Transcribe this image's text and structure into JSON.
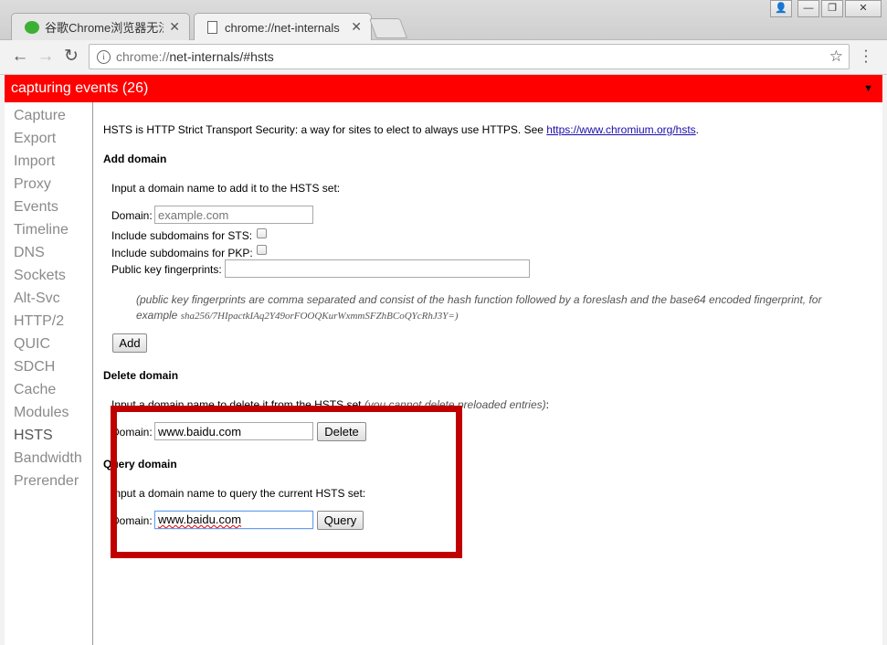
{
  "browser": {
    "tabs": [
      {
        "title": "谷歌Chrome浏览器无法",
        "icon": "wechat-icon"
      },
      {
        "title": "chrome://net-internals",
        "icon": "page-icon"
      }
    ],
    "window_buttons": [
      "user-icon",
      "minimize-icon",
      "restore-icon",
      "close-icon"
    ],
    "omnibox": {
      "scheme": "chrome://",
      "rest": "net-internals/#hsts"
    }
  },
  "status_bar": {
    "text": "capturing events (26)",
    "color": "#ff0000"
  },
  "sidebar": {
    "items": [
      "Capture",
      "Export",
      "Import",
      "Proxy",
      "Events",
      "Timeline",
      "DNS",
      "Sockets",
      "Alt-Svc",
      "HTTP/2",
      "QUIC",
      "SDCH",
      "Cache",
      "Modules",
      "HSTS",
      "Bandwidth",
      "Prerender"
    ],
    "active": "HSTS"
  },
  "hsts": {
    "intro": "HSTS is HTTP Strict Transport Security: a way for sites to elect to always use HTTPS. See ",
    "intro_link": "https://www.chromium.org/hsts",
    "intro_end": ".",
    "add": {
      "heading": "Add domain",
      "instruction": "Input a domain name to add it to the HSTS set:",
      "domain_label": "Domain:",
      "domain_placeholder": "example.com",
      "sts_label": "Include subdomains for STS:",
      "pkp_label": "Include subdomains for PKP:",
      "fingerprints_label": "Public key fingerprints:",
      "note_line1": "(public key fingerprints are comma separated and consist of the hash function followed by a foreslash and the base64 encoded fingerprint, for",
      "note_example_word": "example",
      "note_example_value": "sha256/7HIpactkIAq2Y49orFOOQKurWxmmSFZhBCoQYcRhJ3Y=)",
      "button": "Add"
    },
    "delete": {
      "heading": "Delete domain",
      "instruction": "Input a domain name to delete it from the HSTS set ",
      "instruction_italic": "(you cannot delete preloaded entries)",
      "instruction_end": ":",
      "domain_label": "Domain:",
      "domain_value": "www.baidu.com",
      "button": "Delete"
    },
    "query": {
      "heading": "Query domain",
      "instruction": "Input a domain name to query the current HSTS set:",
      "domain_label": "Domain:",
      "domain_value": "www.baidu.com",
      "button": "Query"
    }
  },
  "annotation": {
    "color": "#c00000"
  }
}
